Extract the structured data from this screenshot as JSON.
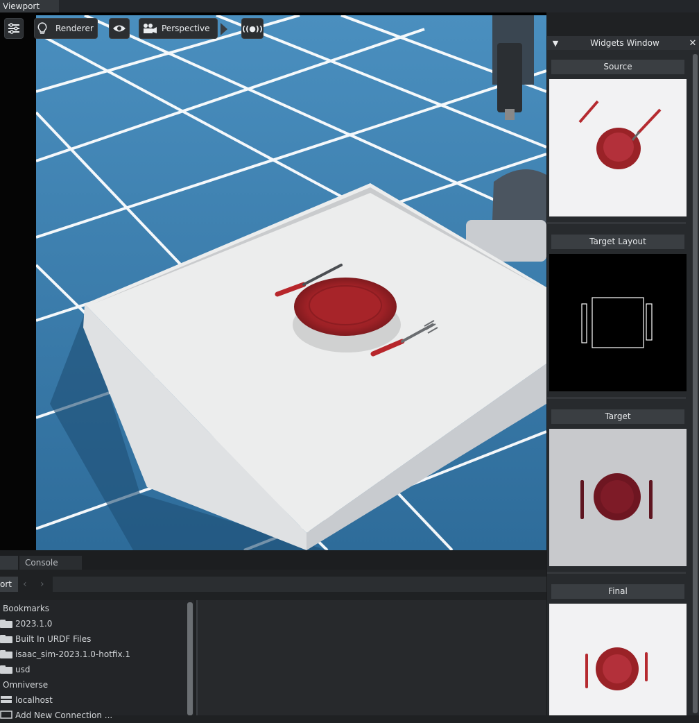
{
  "window": {
    "title": "Viewport"
  },
  "viewport_toolbar": {
    "settings_icon": "sliders-icon",
    "renderer_label": "Renderer",
    "renderer_icon": "lightbulb-icon",
    "visibility_icon": "eye-icon",
    "camera_label": "Perspective",
    "camera_icon": "camera-icon",
    "live_icon": "broadcast-icon",
    "live_label": "((●))"
  },
  "widgets_window": {
    "title": "Widgets Window",
    "collapse_glyph": "▼",
    "close_glyph": "✕",
    "sections": [
      {
        "label": "Source"
      },
      {
        "label": "Target Layout"
      },
      {
        "label": "Target"
      },
      {
        "label": "Final"
      }
    ]
  },
  "bottom_panel": {
    "tabs": [
      "",
      "Console"
    ],
    "address_label": "ort",
    "nav_back": "‹",
    "nav_forward": "›",
    "tree": [
      {
        "label": "Bookmarks",
        "icon": "none"
      },
      {
        "label": "2023.1.0",
        "icon": "folder-icon"
      },
      {
        "label": "Built In URDF Files",
        "icon": "folder-icon"
      },
      {
        "label": "isaac_sim-2023.1.0-hotfix.1",
        "icon": "folder-icon"
      },
      {
        "label": "usd",
        "icon": "folder-icon"
      },
      {
        "label": "Omniverse",
        "icon": "none"
      },
      {
        "label": "localhost",
        "icon": "server-icon"
      },
      {
        "label": "Add New Connection ...",
        "icon": "plus-icon"
      }
    ]
  },
  "colors": {
    "floor_tile": "#3b7fb0",
    "grid_line": "#ffffff",
    "plate": "#a8262b",
    "panel_bg": "#272a2d"
  }
}
